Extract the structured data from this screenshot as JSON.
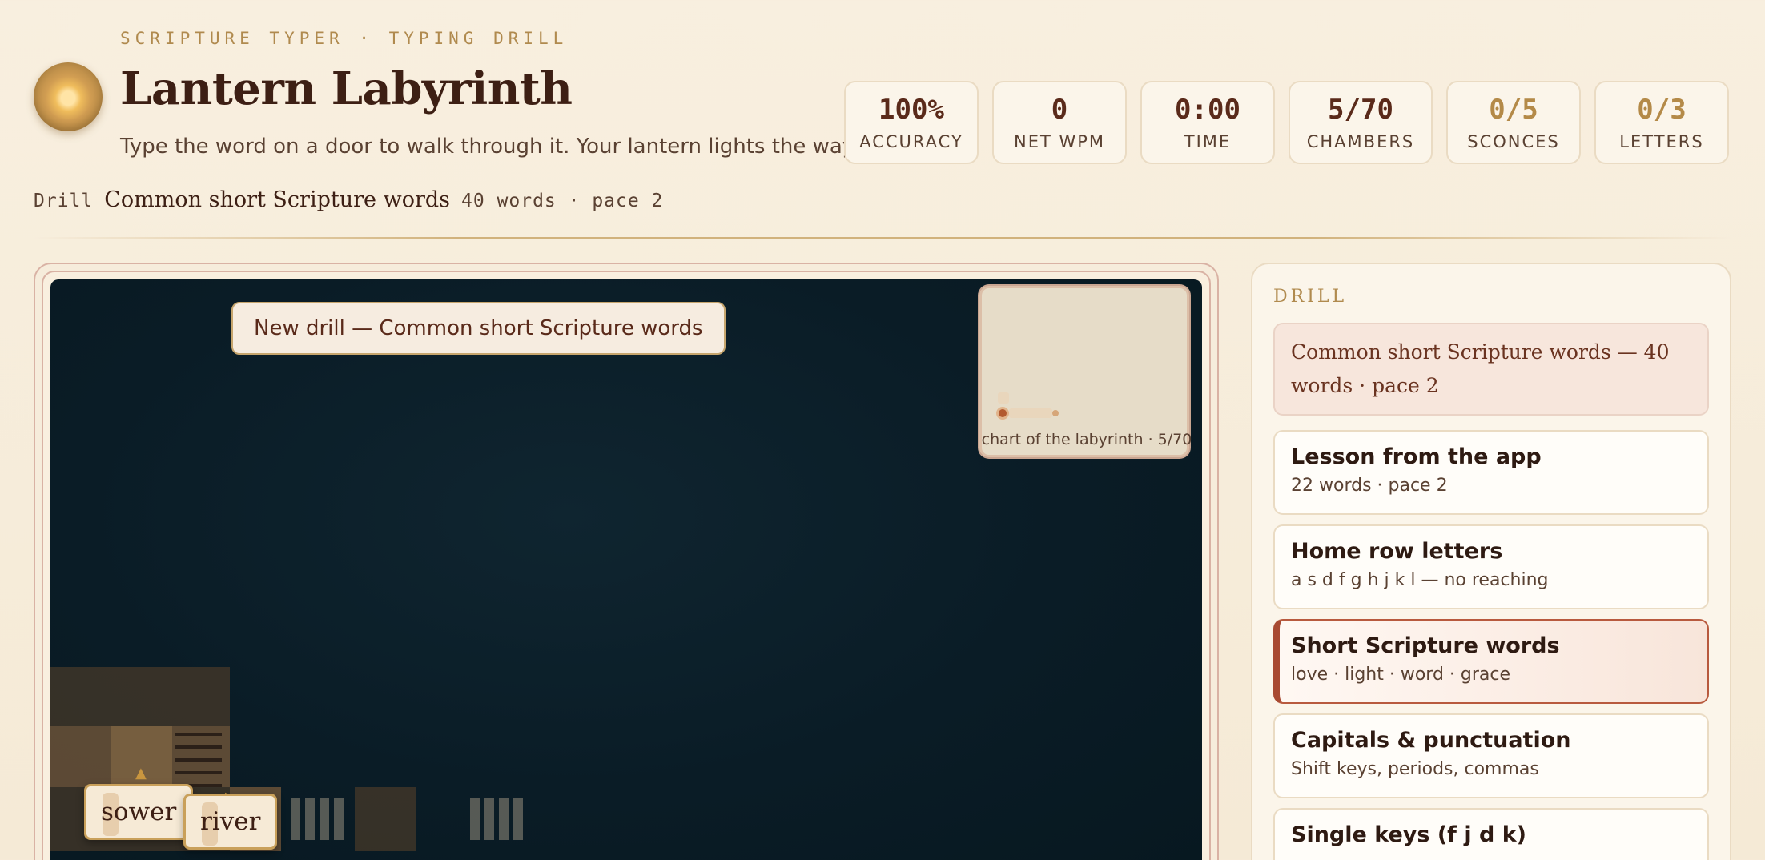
{
  "header": {
    "eyebrow": "SCRIPTURE TYPER · TYPING DRILL",
    "title": "Lantern Labyrinth",
    "subtitle": "Type the word on a door to walk through it. Your lantern lights the way."
  },
  "stats": [
    {
      "value": "100%",
      "label": "ACCURACY"
    },
    {
      "value": "0",
      "label": "NET WPM"
    },
    {
      "value": "0:00",
      "label": "TIME"
    },
    {
      "value": "5/70",
      "label": "CHAMBERS"
    },
    {
      "value": "0/5",
      "label": "SCONCES"
    },
    {
      "value": "0/3",
      "label": "LETTERS"
    }
  ],
  "drill_line": {
    "tag": "Drill",
    "name": "Common short Scripture words",
    "meta": "40 words · pace 2"
  },
  "game": {
    "banner": "New drill — Common short Scripture words",
    "minimap_label": "chart of the labyrinth · 5/70",
    "doors": [
      "sower",
      "river"
    ]
  },
  "panel": {
    "heading": "DRILL",
    "current": "Common short Scripture words — 40 words · pace 2",
    "options": [
      {
        "title": "Lesson from the app",
        "sub": "22 words · pace 2"
      },
      {
        "title": "Home row letters",
        "sub": "a s d f g h j k l — no reaching"
      },
      {
        "title": "Short Scripture words",
        "sub": "love · light · word · grace"
      },
      {
        "title": "Capitals & punctuation",
        "sub": "Shift keys, periods, commas"
      },
      {
        "title": "Single keys (f j d k)",
        "sub": ""
      }
    ]
  },
  "colors": {
    "accent": "#a84a32",
    "gold": "#b48a48",
    "maze_bg": "#0a1c26"
  }
}
